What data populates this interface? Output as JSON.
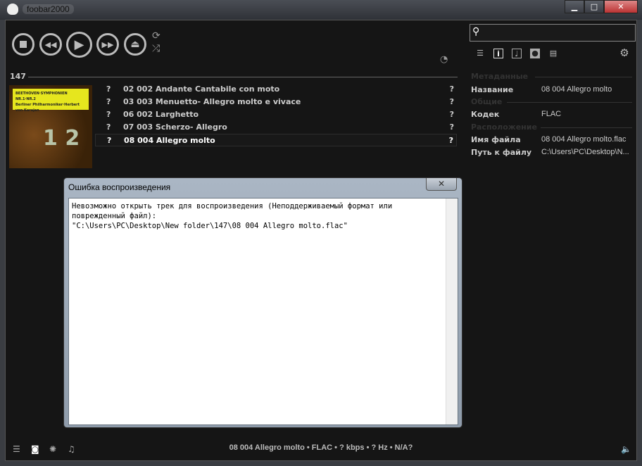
{
  "window": {
    "title": "foobar2000",
    "min": "▁",
    "max": "□",
    "close": "✕"
  },
  "playlist": {
    "count": "147",
    "tracks": [
      {
        "q1": "?",
        "title": "02 002 Andante Cantabile con moto",
        "q2": "?"
      },
      {
        "q1": "?",
        "title": "03 003 Menuetto- Allegro molto e vivace",
        "q2": "?"
      },
      {
        "q1": "?",
        "title": "06 002 Larghetto",
        "q2": "?"
      },
      {
        "q1": "?",
        "title": "07 003 Scherzo- Allegro",
        "q2": "?"
      },
      {
        "q1": "?",
        "title": "08 004 Allegro molto",
        "q2": "?"
      }
    ]
  },
  "cover": {
    "band1": "BEETHOVEN·SYMPHONIEN NR.1·NR.2",
    "band2": "Berliner Philharmoniker·Herbert von Karajan",
    "nums": "1 2"
  },
  "properties": {
    "sec_meta": "Метаданные",
    "name_label": "Название",
    "name_value": "08 004 Allegro molto",
    "sec_general": "Общие",
    "codec_label": "Кодек",
    "codec_value": "FLAC",
    "sec_location": "Расположение",
    "file_label": "Имя файла",
    "file_value": "08 004 Allegro molto.flac",
    "path_label": "Путь к файлу",
    "path_value": "C:\\Users\\PC\\Desktop\\N..."
  },
  "status": {
    "text": "08 004 Allegro molto • FLAC • ? kbps • ? Hz • N/A?"
  },
  "dialog": {
    "title": "Ошибка воспроизведения",
    "close": "✕",
    "message": "Невозможно открыть трек для воспроизведения (Неподдерживаемый формат или\nповрежденный файл):\n\"C:\\Users\\PC\\Desktop\\New folder\\147\\08 004 Allegro molto.flac\""
  }
}
